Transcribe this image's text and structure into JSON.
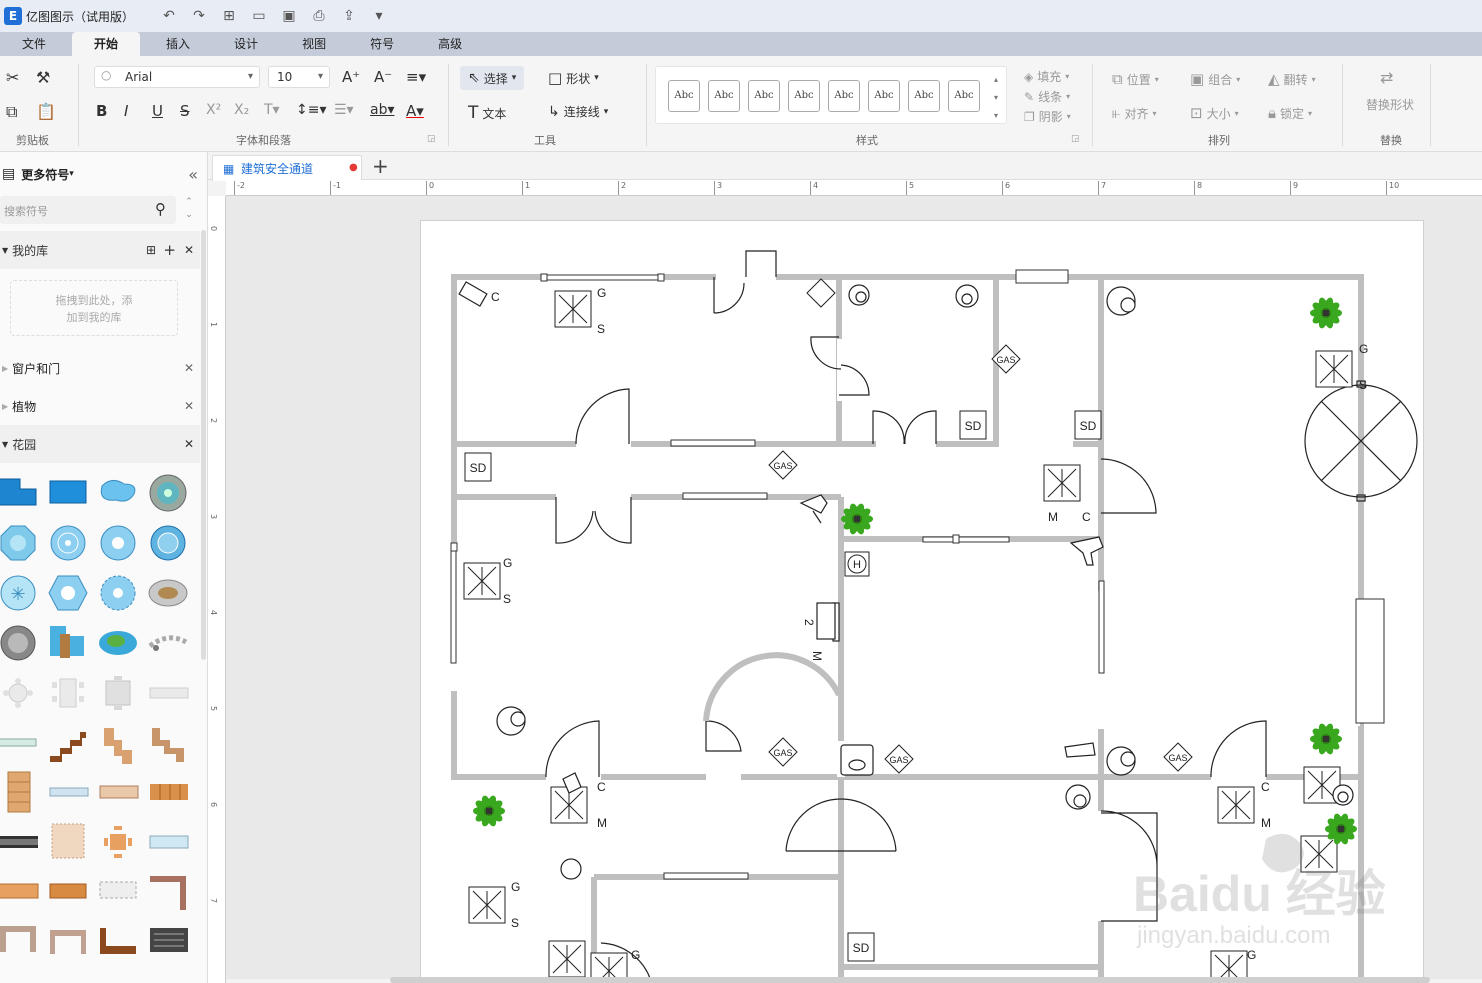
{
  "app": {
    "title": "亿图图示（试用版）",
    "icon": "E"
  },
  "menu": [
    "文件",
    "开始",
    "插入",
    "设计",
    "视图",
    "符号",
    "高级"
  ],
  "ribbon": {
    "clipboard_label": "剪贴板",
    "font": {
      "family": "Arial",
      "size": "10",
      "label": "字体和段落"
    },
    "tools": {
      "select": "选择",
      "shape": "形状",
      "text": "文本",
      "connector": "连接线",
      "label": "工具"
    },
    "styles": {
      "sample": "Abc",
      "label": "样式"
    },
    "format": {
      "fill": "填充",
      "line": "线条",
      "shadow": "阴影"
    },
    "arrange": {
      "position": "位置",
      "group": "组合",
      "flip": "翻转",
      "align": "对齐",
      "size": "大小",
      "lock": "锁定",
      "label": "排列"
    },
    "replace": {
      "btn": "替换形状",
      "label": "替换"
    }
  },
  "sidebar": {
    "more_symbols": "更多符号",
    "search_placeholder": "搜索符号",
    "my_library": "我的库",
    "drop_hint_1": "拖拽到此处，添",
    "drop_hint_2": "加到我的库",
    "sections": [
      "窗户和门",
      "植物",
      "花园"
    ]
  },
  "document": {
    "tab_title": "建筑安全通道"
  },
  "ruler": {
    "h_ticks": [
      "-2",
      "-1",
      "0",
      "1",
      "2",
      "3",
      "4",
      "5",
      "6",
      "7",
      "8",
      "9",
      "10",
      "1"
    ],
    "v_ticks": [
      "0",
      "1",
      "2",
      "3",
      "4",
      "5",
      "6",
      "7"
    ]
  },
  "plan_labels": {
    "sd": "SD",
    "gas": "GAS",
    "g": "G",
    "s": "S",
    "c": "C",
    "m": "M",
    "h": "H",
    "two": "2"
  },
  "watermark": {
    "main": "Baidu 经验",
    "sub": "jingyan.baidu.com"
  },
  "colors": {
    "accent": "#1f6fd6",
    "wall": "#bfbfbf",
    "plant": "#3aa81e",
    "pool": "#4ab0e0"
  }
}
